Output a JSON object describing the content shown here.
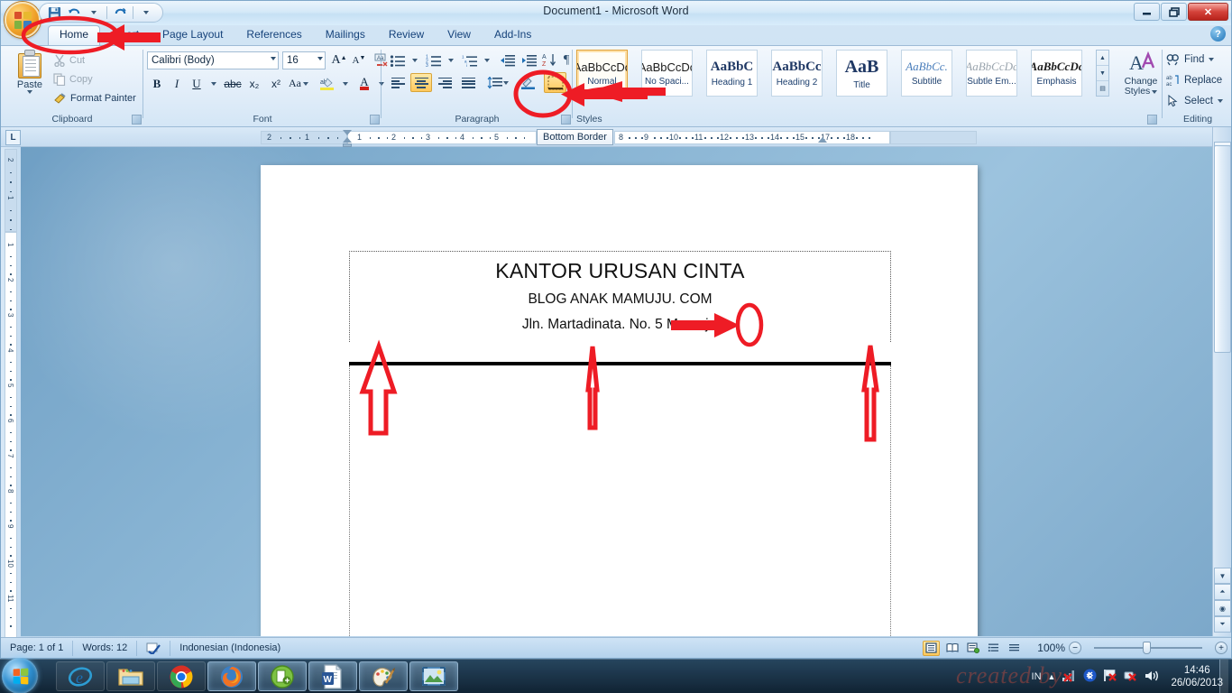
{
  "window": {
    "title": "Document1 - Microsoft Word",
    "minimize_label": "–",
    "restore_label": "❐",
    "close_label": "✕",
    "help_label": "?"
  },
  "quick_access": {
    "save_icon": "save-icon",
    "undo_icon": "undo-icon",
    "redo_icon": "redo-icon",
    "customize_icon": "chevron-down-icon"
  },
  "ribbon": {
    "tabs": [
      {
        "label": "Home",
        "active": true
      },
      {
        "label": "Insert",
        "active": false
      },
      {
        "label": "Page Layout",
        "active": false
      },
      {
        "label": "References",
        "active": false
      },
      {
        "label": "Mailings",
        "active": false
      },
      {
        "label": "Review",
        "active": false
      },
      {
        "label": "View",
        "active": false
      },
      {
        "label": "Add-Ins",
        "active": false
      }
    ],
    "groups": {
      "clipboard": {
        "label": "Clipboard",
        "paste": "Paste",
        "cut": "Cut",
        "copy": "Copy",
        "format_painter": "Format Painter"
      },
      "font": {
        "label": "Font",
        "font_name": "Calibri (Body)",
        "font_size": "16",
        "grow_label": "A",
        "shrink_label": "A",
        "clear_formatting": "clear-formatting-icon",
        "bold": "B",
        "italic": "I",
        "underline": "U",
        "strikethrough": "abc",
        "subscript": "x₂",
        "superscript": "x²",
        "change_case": "Aa",
        "highlight": "ab",
        "font_color": "A"
      },
      "paragraph": {
        "label": "Paragraph",
        "bullets": "bullets-icon",
        "numbering": "numbering-icon",
        "multilevel": "multilevel-list-icon",
        "decrease_indent": "decrease-indent-icon",
        "increase_indent": "increase-indent-icon",
        "sort": "sort-icon",
        "show_marks": "¶",
        "align_left": "align-left-icon",
        "align_center": "align-center-icon",
        "align_right": "align-right-icon",
        "justify": "justify-icon",
        "line_spacing": "line-spacing-icon",
        "shading": "shading-icon",
        "borders": "borders-icon"
      },
      "styles": {
        "label": "Styles",
        "items": [
          {
            "preview": "AaBbCcDc",
            "name": "Normal",
            "selected": true
          },
          {
            "preview": "AaBbCcDc",
            "name": "No Spaci...",
            "selected": false
          },
          {
            "preview": "AaBbC",
            "name": "Heading 1",
            "selected": false
          },
          {
            "preview": "AaBbCc",
            "name": "Heading 2",
            "selected": false
          },
          {
            "preview": "AaB",
            "name": "Title",
            "selected": false
          },
          {
            "preview": "AaBbCc.",
            "name": "Subtitle",
            "selected": false
          },
          {
            "preview": "AaBbCcDc",
            "name": "Subtle Em...",
            "selected": false
          },
          {
            "preview": "AaBbCcDc",
            "name": "Emphasis",
            "selected": false
          }
        ],
        "change_styles_line1": "Change",
        "change_styles_line2": "Styles"
      },
      "editing": {
        "label": "Editing",
        "find": "Find",
        "replace": "Replace",
        "select": "Select"
      }
    }
  },
  "ruler": {
    "tab_selector": "L",
    "tooltip": "Bottom Border",
    "h_left_marks": [
      "2",
      "1"
    ],
    "h_marks": [
      "1",
      "2",
      "3",
      "4",
      "5"
    ],
    "h_marks_right": [
      "8",
      "9",
      "10",
      "11",
      "12",
      "13",
      "14",
      "15",
      "17",
      "18"
    ],
    "v_top_marks": [
      "2",
      "1"
    ],
    "v_marks": [
      "1",
      "2",
      "3",
      "4",
      "5",
      "6",
      "7",
      "8",
      "9",
      "10",
      "11"
    ]
  },
  "document": {
    "line1": "KANTOR URUSAN CINTA",
    "line2": "BLOG ANAK MAMUJU. COM",
    "line3": "Jln. Martadinata. No. 5 Mamuju"
  },
  "status_bar": {
    "page": "Page: 1 of 1",
    "words": "Words: 12",
    "proofing_icon": "proofing-errors-icon",
    "language": "Indonesian (Indonesia)",
    "views": [
      "print-layout-icon",
      "full-screen-reading-icon",
      "web-layout-icon",
      "outline-icon",
      "draft-icon"
    ],
    "zoom": "100%",
    "zoom_out": "−",
    "zoom_in": "+"
  },
  "taskbar": {
    "start": "start-orb",
    "items": [
      {
        "name": "internet-explorer",
        "running": false
      },
      {
        "name": "file-explorer",
        "running": false
      },
      {
        "name": "google-chrome",
        "running": false
      },
      {
        "name": "mozilla-firefox",
        "running": true
      },
      {
        "name": "green-app",
        "running": true
      },
      {
        "name": "microsoft-word",
        "running": true
      },
      {
        "name": "paint",
        "running": true
      },
      {
        "name": "photo-viewer",
        "running": true
      }
    ],
    "tray": {
      "language": "IN",
      "show_hidden": "chevron-up-icon",
      "network": "network-error-icon",
      "bluetooth": "bluetooth-icon",
      "action_center": "action-center-error-icon",
      "power": "power-error-icon",
      "volume": "volume-icon",
      "time": "14:46",
      "date": "26/06/2013"
    },
    "watermark": "created by"
  },
  "annotations": {
    "home_tab_circle": "red-ellipse-home-tab",
    "home_tab_arrow": "red-arrow-to-home",
    "normal_style_arrow": "red-arrow-to-normal-style",
    "borders_circle": "red-ellipse-borders-button",
    "borders_arrow": "red-arrow-to-borders",
    "cursor_circle": "red-ellipse-text-cursor",
    "cursor_arrow": "red-arrow-to-cursor",
    "border_up_arrows": [
      "red-up-arrow-left",
      "red-up-arrow-center",
      "red-up-arrow-right"
    ]
  },
  "colors": {
    "annotation": "#ee1c25",
    "accent": "#1c4e80",
    "highlight": "#ffc85c"
  }
}
